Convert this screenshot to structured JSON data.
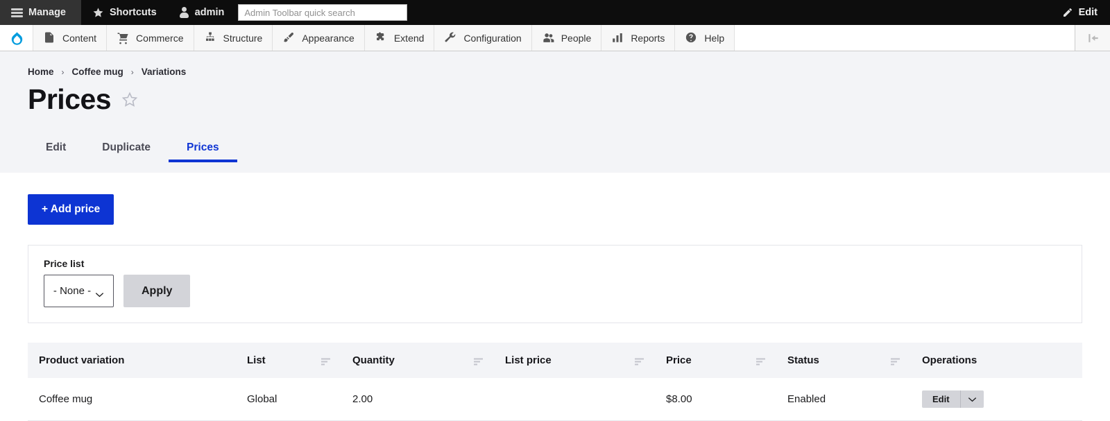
{
  "admin_toolbar": {
    "manage": "Manage",
    "shortcuts": "Shortcuts",
    "user": "admin",
    "search_placeholder": "Admin Toolbar quick search",
    "search_value": "",
    "edit": "Edit"
  },
  "menu_bar": {
    "items": [
      {
        "label": "Content",
        "icon": "document-icon"
      },
      {
        "label": "Commerce",
        "icon": "cart-icon"
      },
      {
        "label": "Structure",
        "icon": "sitemap-icon"
      },
      {
        "label": "Appearance",
        "icon": "paintbrush-icon"
      },
      {
        "label": "Extend",
        "icon": "puzzle-icon"
      },
      {
        "label": "Configuration",
        "icon": "wrench-icon"
      },
      {
        "label": "People",
        "icon": "people-icon"
      },
      {
        "label": "Reports",
        "icon": "bar-chart-icon"
      },
      {
        "label": "Help",
        "icon": "question-circle-icon"
      }
    ]
  },
  "breadcrumb": [
    {
      "label": "Home"
    },
    {
      "label": "Coffee mug"
    },
    {
      "label": "Variations"
    }
  ],
  "breadcrumb_separator": "›",
  "page": {
    "title": "Prices"
  },
  "tabs": [
    {
      "label": "Edit",
      "active": false
    },
    {
      "label": "Duplicate",
      "active": false
    },
    {
      "label": "Prices",
      "active": true
    }
  ],
  "actions": {
    "add_price": "+ Add price"
  },
  "filter": {
    "label": "Price list",
    "selected": "- None -",
    "options": [
      "- None -"
    ],
    "apply": "Apply"
  },
  "table": {
    "columns": [
      {
        "label": "Product variation",
        "sortable": false
      },
      {
        "label": "List",
        "sortable": true
      },
      {
        "label": "Quantity",
        "sortable": true
      },
      {
        "label": "List price",
        "sortable": true
      },
      {
        "label": "Price",
        "sortable": true
      },
      {
        "label": "Status",
        "sortable": true
      },
      {
        "label": "Operations",
        "sortable": false
      }
    ],
    "rows": [
      {
        "product_variation": "Coffee mug",
        "list": "Global",
        "quantity": "2.00",
        "list_price": "",
        "price": "$8.00",
        "status": "Enabled",
        "operation_label": "Edit"
      }
    ]
  },
  "colors": {
    "accent": "#0d34d3",
    "toolbar_bg": "#0d0d0d",
    "header_bg": "#f3f4f7",
    "button_gray": "#d3d4d9"
  }
}
